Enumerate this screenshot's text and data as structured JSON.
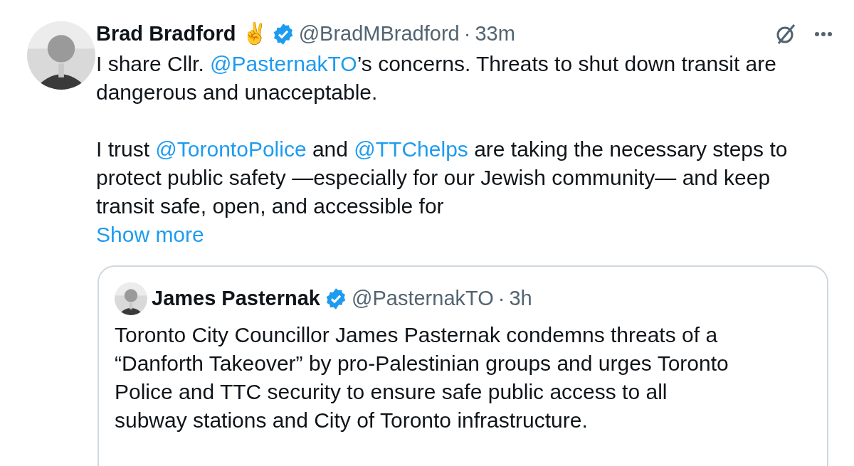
{
  "post": {
    "author": "Brad Bradford ✌️",
    "verified": true,
    "handle": "@BradMBradford",
    "separator": "·",
    "time": "33m",
    "paragraphs": [
      [
        {
          "kind": "text",
          "text": "I share Cllr. "
        },
        {
          "kind": "mention",
          "text": "@PasternakTO"
        },
        {
          "kind": "text",
          "text": "’s concerns. Threats to shut down transit are dangerous and unacceptable."
        }
      ],
      [
        {
          "kind": "text",
          "text": "I trust "
        },
        {
          "kind": "mention",
          "text": "@TorontoPolice"
        },
        {
          "kind": "text",
          "text": " and "
        },
        {
          "kind": "mention",
          "text": "@TTChelps"
        },
        {
          "kind": "text",
          "text": " are taking the necessary steps to protect public safety —especially for our Jewish community— and keep transit safe, open, and accessible for"
        }
      ]
    ],
    "show_more": "Show more",
    "quote": {
      "author": "James Pasternak",
      "verified": true,
      "handle": "@PasternakTO",
      "separator": "·",
      "time": "3h",
      "text": "Toronto City Councillor James Pasternak condemns threats of a “Danforth Takeover” by pro-Palestinian groups and urges Toronto Police and TTC security to ensure safe public access to all subway stations and City of Toronto infrastructure."
    }
  }
}
